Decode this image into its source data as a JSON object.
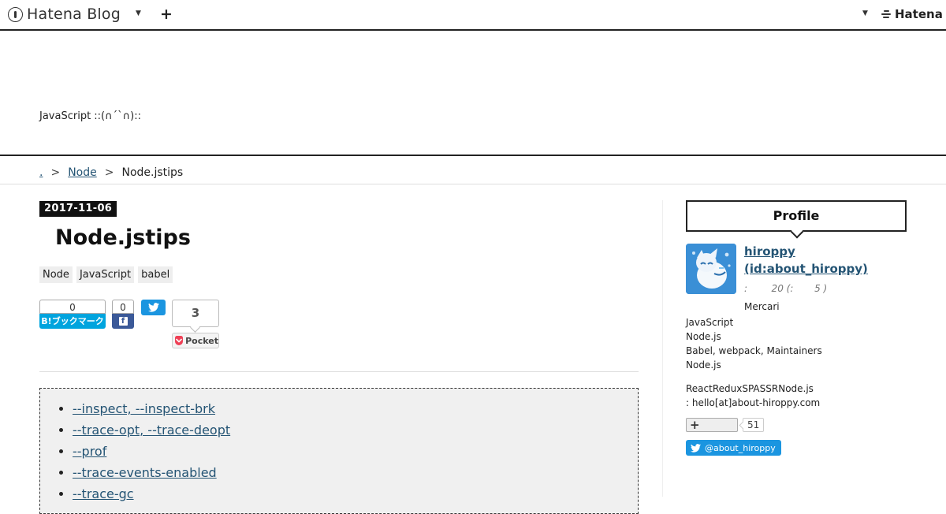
{
  "globalbar": {
    "logo_text": "Hatena Blog",
    "brand": "Hatena"
  },
  "header": {
    "description": "JavaScript ::(∩´`∩)::"
  },
  "breadcrumb": {
    "home": ".",
    "category": "Node",
    "current": "Node.jstips"
  },
  "entry": {
    "date": "2017-11-06",
    "title": "Node.jstips",
    "tags": [
      "Node",
      "JavaScript",
      "babel"
    ],
    "share": {
      "hatena_count": "0",
      "hatena_label": "B!ブックマーク",
      "facebook_count": "0",
      "pocket_count": "3",
      "pocket_label": "Pocket"
    },
    "toc": [
      "--inspect, --inspect-brk",
      "--trace-opt, --trace-deopt",
      "--prof",
      "--trace-events-enabled",
      "--trace-gc"
    ]
  },
  "sidebar": {
    "profile_title": "Profile",
    "name_line1": "hiroppy",
    "name_line2": "(id:about_hiroppy)",
    "meta": ":        20 (:       5 )",
    "company": "Mercari",
    "desc": [
      "JavaScript",
      "Node.js",
      "Babel, webpack, Maintainers",
      "Node.js"
    ],
    "desc2": [
      "ReactReduxSPASSRNode.js",
      ": hello[at]about-hiroppy.com"
    ],
    "follow_count": "51",
    "twitter_handle": "@about_hiroppy"
  },
  "colors": {
    "link": "#245474",
    "hatena_bookmark": "#00a4de",
    "facebook": "#3b5998",
    "twitter": "#1b95e0",
    "pocket": "#ef4056"
  }
}
